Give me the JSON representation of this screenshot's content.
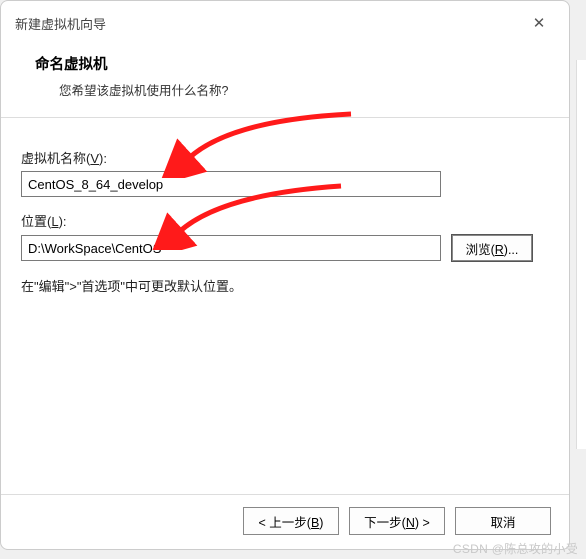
{
  "titlebar": {
    "title": "新建虚拟机向导",
    "close_icon": "✕"
  },
  "header": {
    "title": "命名虚拟机",
    "subtitle": "您希望该虚拟机使用什么名称?"
  },
  "fields": {
    "name_label_prefix": "虚拟机名称(",
    "name_label_hotkey": "V",
    "name_label_suffix": "):",
    "name_value": "CentOS_8_64_develop",
    "location_label_prefix": "位置(",
    "location_label_hotkey": "L",
    "location_label_suffix": "):",
    "location_value": "D:\\WorkSpace\\CentOS",
    "browse_prefix": "浏览(",
    "browse_hotkey": "R",
    "browse_suffix": ")..."
  },
  "note": "在\"编辑\">\"首选项\"中可更改默认位置。",
  "footer": {
    "back_prefix": "< 上一步(",
    "back_hotkey": "B",
    "back_suffix": ")",
    "next_prefix": "下一步(",
    "next_hotkey": "N",
    "next_suffix": ") >",
    "cancel": "取消"
  },
  "watermark": "CSDN @陈总攻的小受",
  "colors": {
    "arrow": "#ff1a1a"
  }
}
